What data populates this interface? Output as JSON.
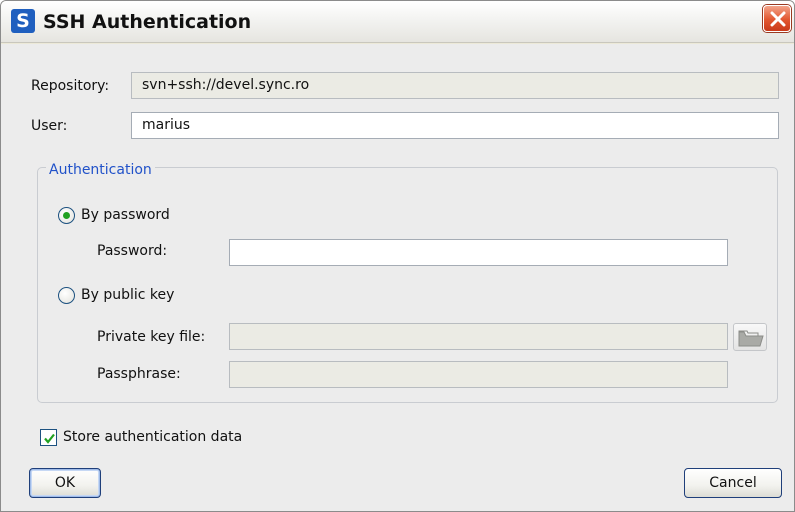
{
  "window": {
    "title": "SSH Authentication",
    "app_icon_letter": "S"
  },
  "form": {
    "repository_label": "Repository:",
    "repository_value": "svn+ssh://devel.sync.ro",
    "user_label": "User:",
    "user_value": "marius"
  },
  "authentication": {
    "group_title": "Authentication",
    "by_password_label": "By password",
    "by_password_selected": true,
    "password_label": "Password:",
    "password_value": "",
    "by_public_key_label": "By public key",
    "by_public_key_selected": false,
    "private_key_label": "Private key file:",
    "private_key_value": "",
    "passphrase_label": "Passphrase:",
    "passphrase_value": ""
  },
  "store": {
    "label": "Store authentication data",
    "checked": true
  },
  "buttons": {
    "ok": "OK",
    "cancel": "Cancel"
  },
  "icons": [
    "app-logo-icon",
    "close-icon",
    "folder-icon",
    "checkmark-icon"
  ],
  "colors": {
    "group_title": "#2152c9",
    "radio_dot": "#21a121",
    "checkmark": "#21a121",
    "close_button": "#e2562f"
  }
}
